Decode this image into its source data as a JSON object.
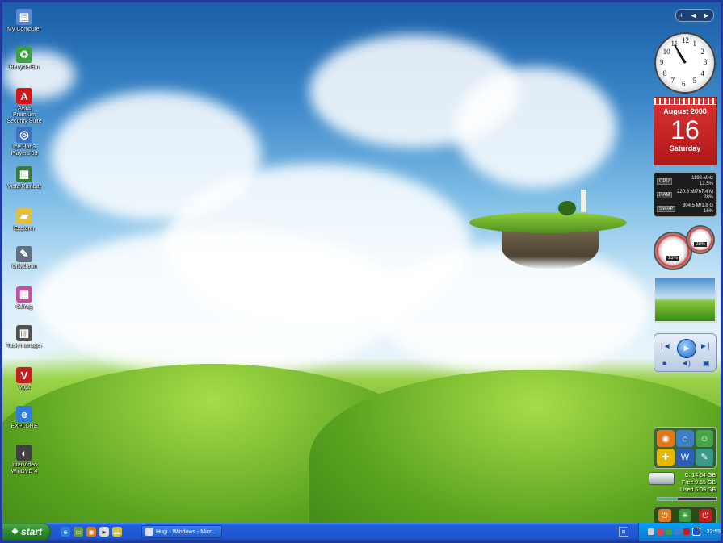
{
  "desktop_icons": [
    {
      "label": "My Computer",
      "icon": "computer-icon",
      "color": "#5a8ad0"
    },
    {
      "label": "Recycle Bin",
      "icon": "recycle-bin-icon",
      "color": "#3aa040"
    },
    {
      "label": "Avira Premium Security Suite",
      "icon": "avira-icon",
      "color": "#d01818"
    },
    {
      "label": "Ice Hot 3 Players 09",
      "icon": "media-icon",
      "color": "#4070c0"
    },
    {
      "label": "Vista Rainbar",
      "icon": "rainbar-icon",
      "color": "#3a7a40"
    },
    {
      "label": "Explorer",
      "icon": "folder-icon",
      "color": "#e0c040"
    },
    {
      "label": "Diskclean",
      "icon": "diskclean-icon",
      "color": "#607080"
    },
    {
      "label": "defrag",
      "icon": "defrag-icon",
      "color": "#c050a0"
    },
    {
      "label": "Task manager",
      "icon": "task-manager-icon",
      "color": "#505050"
    },
    {
      "label": "Vopt",
      "icon": "vopt-icon",
      "color": "#c02020"
    },
    {
      "label": "EXPLORE",
      "icon": "internet-explorer-icon",
      "color": "#2f7fd8"
    },
    {
      "label": "InterVideo WinDVD 4",
      "icon": "dvd-icon",
      "color": "#404040"
    }
  ],
  "sidebar": {
    "controls": [
      "+",
      "◄",
      "►"
    ],
    "clock": {
      "numbers": [
        "12",
        "1",
        "2",
        "3",
        "4",
        "5",
        "6",
        "7",
        "8",
        "9",
        "10",
        "11"
      ],
      "hour": 10.9,
      "minute": 55
    },
    "calendar": {
      "month": "August 2008",
      "day": "16",
      "weekday": "Saturday"
    },
    "system_monitor": {
      "cpu": {
        "tag": "CPU",
        "line1": "1196 MHz",
        "line2": "12.5%"
      },
      "ram": {
        "tag": "RAM",
        "line1": "220.6 M/767.4 M",
        "line2": "28%"
      },
      "swap": {
        "tag": "SWAP",
        "line1": "304.5 M/1.8 G",
        "line2": "16%"
      }
    },
    "gauges": {
      "left": "13%",
      "right": "28%"
    },
    "drive": {
      "capacity": "C: 14.64 GB",
      "free": "Free 9.55 GB",
      "used": "Used 5.09 GB",
      "used_fraction": 0.35
    },
    "launcher_icons": [
      "firefox-icon",
      "home-icon",
      "users-icon",
      "puzzle-icon",
      "word-icon",
      "notepad-icon"
    ],
    "power_buttons": [
      "power-icon",
      "sleep-icon",
      "shutdown-icon"
    ]
  },
  "taskbar": {
    "start_label": "start",
    "quick_launch": [
      "ie-icon",
      "show-desktop-icon",
      "firefox-icon",
      "media-player-icon",
      "folder-icon"
    ],
    "active_task": "Hugi - Windows - Micr...",
    "tray_time": "22:55",
    "tray_icons": [
      "network-icon",
      "antivirus-icon",
      "security-icon",
      "safely-remove-icon",
      "avira-tray-icon",
      "volume-icon"
    ]
  }
}
